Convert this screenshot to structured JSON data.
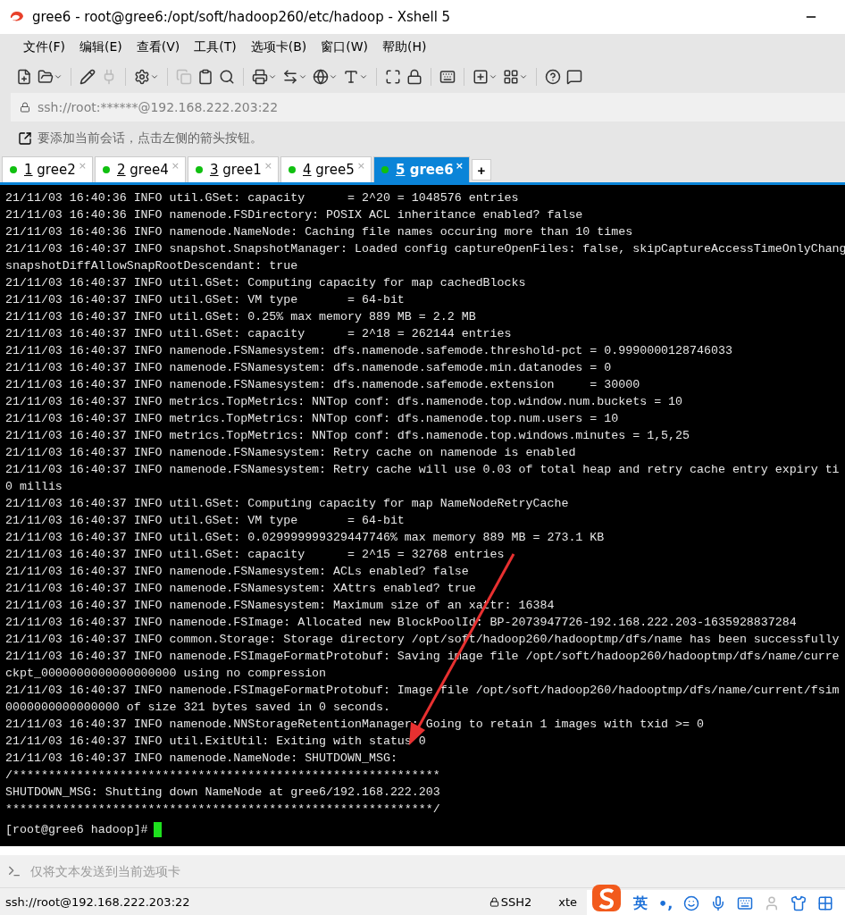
{
  "window": {
    "title": "gree6 - root@gree6:/opt/soft/hadoop260/etc/hadoop - Xshell 5"
  },
  "menu": [
    "文件(F)",
    "编辑(E)",
    "查看(V)",
    "工具(T)",
    "选项卡(B)",
    "窗口(W)",
    "帮助(H)"
  ],
  "address_bar": {
    "value": "ssh://root:******@192.168.222.203:22"
  },
  "hint_bar": {
    "text": "要添加当前会话，点击左侧的箭头按钮。"
  },
  "tabs": [
    {
      "number": "1",
      "label": "gree2",
      "selected": false,
      "close": "×"
    },
    {
      "number": "2",
      "label": "gree4",
      "selected": false,
      "close": "×"
    },
    {
      "number": "3",
      "label": "gree1",
      "selected": false,
      "close": "×"
    },
    {
      "number": "4",
      "label": "gree5",
      "selected": false,
      "close": "×"
    },
    {
      "number": "5",
      "label": "gree6",
      "selected": true,
      "close": "×"
    }
  ],
  "new_tab": "+",
  "terminal": {
    "lines": [
      "21/11/03 16:40:36 INFO util.GSet: capacity      = 2^20 = 1048576 entries",
      "21/11/03 16:40:36 INFO namenode.FSDirectory: POSIX ACL inheritance enabled? false",
      "21/11/03 16:40:36 INFO namenode.NameNode: Caching file names occuring more than 10 times",
      "21/11/03 16:40:37 INFO snapshot.SnapshotManager: Loaded config captureOpenFiles: false, skipCaptureAccessTimeOnlyChang",
      "snapshotDiffAllowSnapRootDescendant: true",
      "21/11/03 16:40:37 INFO util.GSet: Computing capacity for map cachedBlocks",
      "21/11/03 16:40:37 INFO util.GSet: VM type       = 64-bit",
      "21/11/03 16:40:37 INFO util.GSet: 0.25% max memory 889 MB = 2.2 MB",
      "21/11/03 16:40:37 INFO util.GSet: capacity      = 2^18 = 262144 entries",
      "21/11/03 16:40:37 INFO namenode.FSNamesystem: dfs.namenode.safemode.threshold-pct = 0.9990000128746033",
      "21/11/03 16:40:37 INFO namenode.FSNamesystem: dfs.namenode.safemode.min.datanodes = 0",
      "21/11/03 16:40:37 INFO namenode.FSNamesystem: dfs.namenode.safemode.extension     = 30000",
      "21/11/03 16:40:37 INFO metrics.TopMetrics: NNTop conf: dfs.namenode.top.window.num.buckets = 10",
      "21/11/03 16:40:37 INFO metrics.TopMetrics: NNTop conf: dfs.namenode.top.num.users = 10",
      "21/11/03 16:40:37 INFO metrics.TopMetrics: NNTop conf: dfs.namenode.top.windows.minutes = 1,5,25",
      "21/11/03 16:40:37 INFO namenode.FSNamesystem: Retry cache on namenode is enabled",
      "21/11/03 16:40:37 INFO namenode.FSNamesystem: Retry cache will use 0.03 of total heap and retry cache entry expiry ti",
      "0 millis",
      "21/11/03 16:40:37 INFO util.GSet: Computing capacity for map NameNodeRetryCache",
      "21/11/03 16:40:37 INFO util.GSet: VM type       = 64-bit",
      "21/11/03 16:40:37 INFO util.GSet: 0.029999999329447746% max memory 889 MB = 273.1 KB",
      "21/11/03 16:40:37 INFO util.GSet: capacity      = 2^15 = 32768 entries",
      "21/11/03 16:40:37 INFO namenode.FSNamesystem: ACLs enabled? false",
      "21/11/03 16:40:37 INFO namenode.FSNamesystem: XAttrs enabled? true",
      "21/11/03 16:40:37 INFO namenode.FSNamesystem: Maximum size of an xattr: 16384",
      "21/11/03 16:40:37 INFO namenode.FSImage: Allocated new BlockPoolId: BP-2073947726-192.168.222.203-1635928837284",
      "21/11/03 16:40:37 INFO common.Storage: Storage directory /opt/soft/hadoop260/hadooptmp/dfs/name has been successfully",
      "21/11/03 16:40:37 INFO namenode.FSImageFormatProtobuf: Saving image file /opt/soft/hadoop260/hadooptmp/dfs/name/curre",
      "ckpt_0000000000000000000 using no compression",
      "21/11/03 16:40:37 INFO namenode.FSImageFormatProtobuf: Image file /opt/soft/hadoop260/hadooptmp/dfs/name/current/fsim",
      "0000000000000000 of size 321 bytes saved in 0 seconds.",
      "21/11/03 16:40:37 INFO namenode.NNStorageRetentionManager: Going to retain 1 images with txid >= 0",
      "21/11/03 16:40:37 INFO util.ExitUtil: Exiting with status 0",
      "21/11/03 16:40:37 INFO namenode.NameNode: SHUTDOWN_MSG:",
      "/************************************************************",
      "SHUTDOWN_MSG: Shutting down NameNode at gree6/192.168.222.203",
      "************************************************************/"
    ],
    "prompt": "[root@gree6 hadoop]#"
  },
  "compose_bar": {
    "placeholder": "仅将文本发送到当前选项卡"
  },
  "status_bar": {
    "connection": "ssh://root@192.168.222.203:22",
    "protocol": "SSH2",
    "terminal_type": "xte"
  },
  "ime_bar": {
    "mode": "英",
    "punct": "•,"
  }
}
